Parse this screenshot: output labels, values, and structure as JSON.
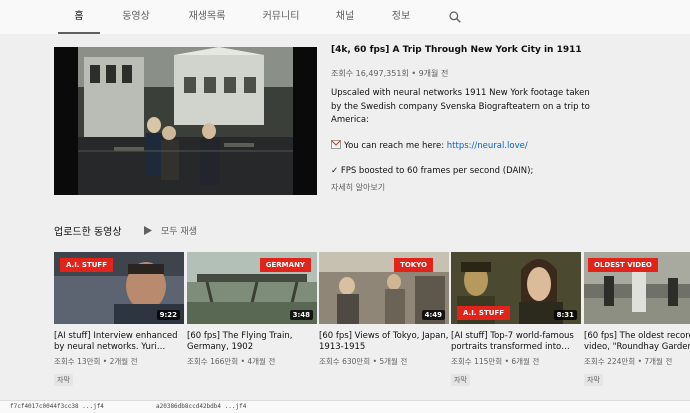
{
  "tabs": [
    {
      "label": "홈"
    },
    {
      "label": "동영상"
    },
    {
      "label": "재생목록"
    },
    {
      "label": "커뮤니티"
    },
    {
      "label": "채널"
    },
    {
      "label": "정보"
    }
  ],
  "featured": {
    "title": "[4k, 60 fps] A Trip Through New York City in 1911",
    "meta": "조회수 16,497,351회 • 9개월 전",
    "description": "Upscaled with neural networks 1911 New York footage taken by the Swedish company Svenska Biografteatern on a trip to America:",
    "contact_prefix": "You can reach me here: ",
    "contact_link": "https://neural.love/",
    "fps_line": "✓ FPS boosted to 60 frames per second (DAIN);",
    "more": "자세히 알아보기"
  },
  "section": {
    "title": "업로드한 동영상",
    "play_all": "모두 재생"
  },
  "videos": [
    {
      "tag": "A.I. STUFF",
      "duration": "9:22",
      "title": "[AI stuff] Interview enhanced by neural networks. Yuri…",
      "meta": "조회수 13만회 • 2개월 전",
      "badge": "자막"
    },
    {
      "tag": "GERMANY",
      "duration": "3:48",
      "title": "[60 fps] The Flying Train, Germany, 1902",
      "meta": "조회수 166만회 • 4개월 전",
      "badge": ""
    },
    {
      "tag": "TOKYO",
      "duration": "4:49",
      "title": "[60 fps] Views of Tokyo, Japan, 1913-1915",
      "meta": "조회수 630만회 • 5개월 전",
      "badge": ""
    },
    {
      "tag": "A.I. STUFF",
      "duration": "8:31",
      "title": "[AI stuff] Top-7 world-famous portraits transformed into…",
      "meta": "조회수 115만회 • 6개월 전",
      "badge": "자막"
    },
    {
      "tag": "OLDEST VIDEO",
      "duration": "",
      "title": "[60 fps] The oldest recorded video, \"Roundhay Garden…",
      "meta": "조회수 224만회 • 7개월 전",
      "badge": "자막"
    }
  ],
  "bottom_strip": [
    "f7cf4017c0044f3cc38 ...jf4",
    "a20386db8ccd42bdb4 ...jf4"
  ]
}
